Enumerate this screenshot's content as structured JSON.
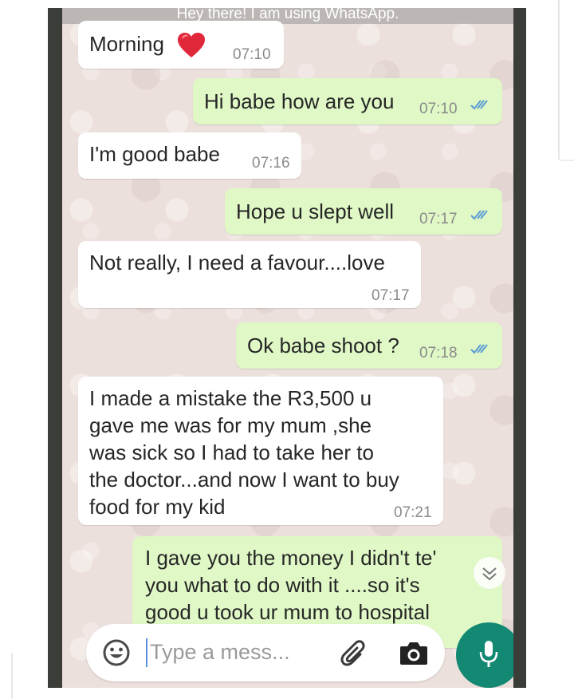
{
  "header": {
    "status": "Hey there! I am using WhatsApp."
  },
  "messages": [
    {
      "dir": "in",
      "text": "Morning",
      "time": "07:10",
      "emoji": "red-heart"
    },
    {
      "dir": "out",
      "text": "Hi babe how are you",
      "time": "07:10"
    },
    {
      "dir": "in",
      "text": "I'm good babe",
      "time": "07:16"
    },
    {
      "dir": "out",
      "text": "Hope u slept well",
      "time": "07:17"
    },
    {
      "dir": "in",
      "text": "Not really, I need a favour....love",
      "time": "07:17"
    },
    {
      "dir": "out",
      "text": "Ok babe shoot ?",
      "time": "07:18"
    },
    {
      "dir": "in",
      "lines": [
        "I made a mistake the R3,500 u",
        "gave me was for my mum ,she",
        "was sick so I had to take her to",
        "the doctor...and now I want to buy",
        "food for my kid"
      ],
      "time": "07:21"
    },
    {
      "dir": "out",
      "lines": [
        "I gave you the money I didn't te'",
        "you what to do with it ....so it's",
        "good u took ur mum to hospital"
      ]
    }
  ],
  "input": {
    "placeholder": "Type a mess..."
  },
  "icons": {
    "emoji": "emoji-icon",
    "attach": "paperclip-icon",
    "camera": "camera-icon",
    "mic": "microphone-icon",
    "scroll": "chevron-down-icon",
    "read": "double-check-icon"
  },
  "colors": {
    "incoming": "#ffffff",
    "outgoing": "#dff8c6",
    "accent": "#138873",
    "read_ticks": "#5a9bd5",
    "chat_bg": "#ece0dc"
  }
}
